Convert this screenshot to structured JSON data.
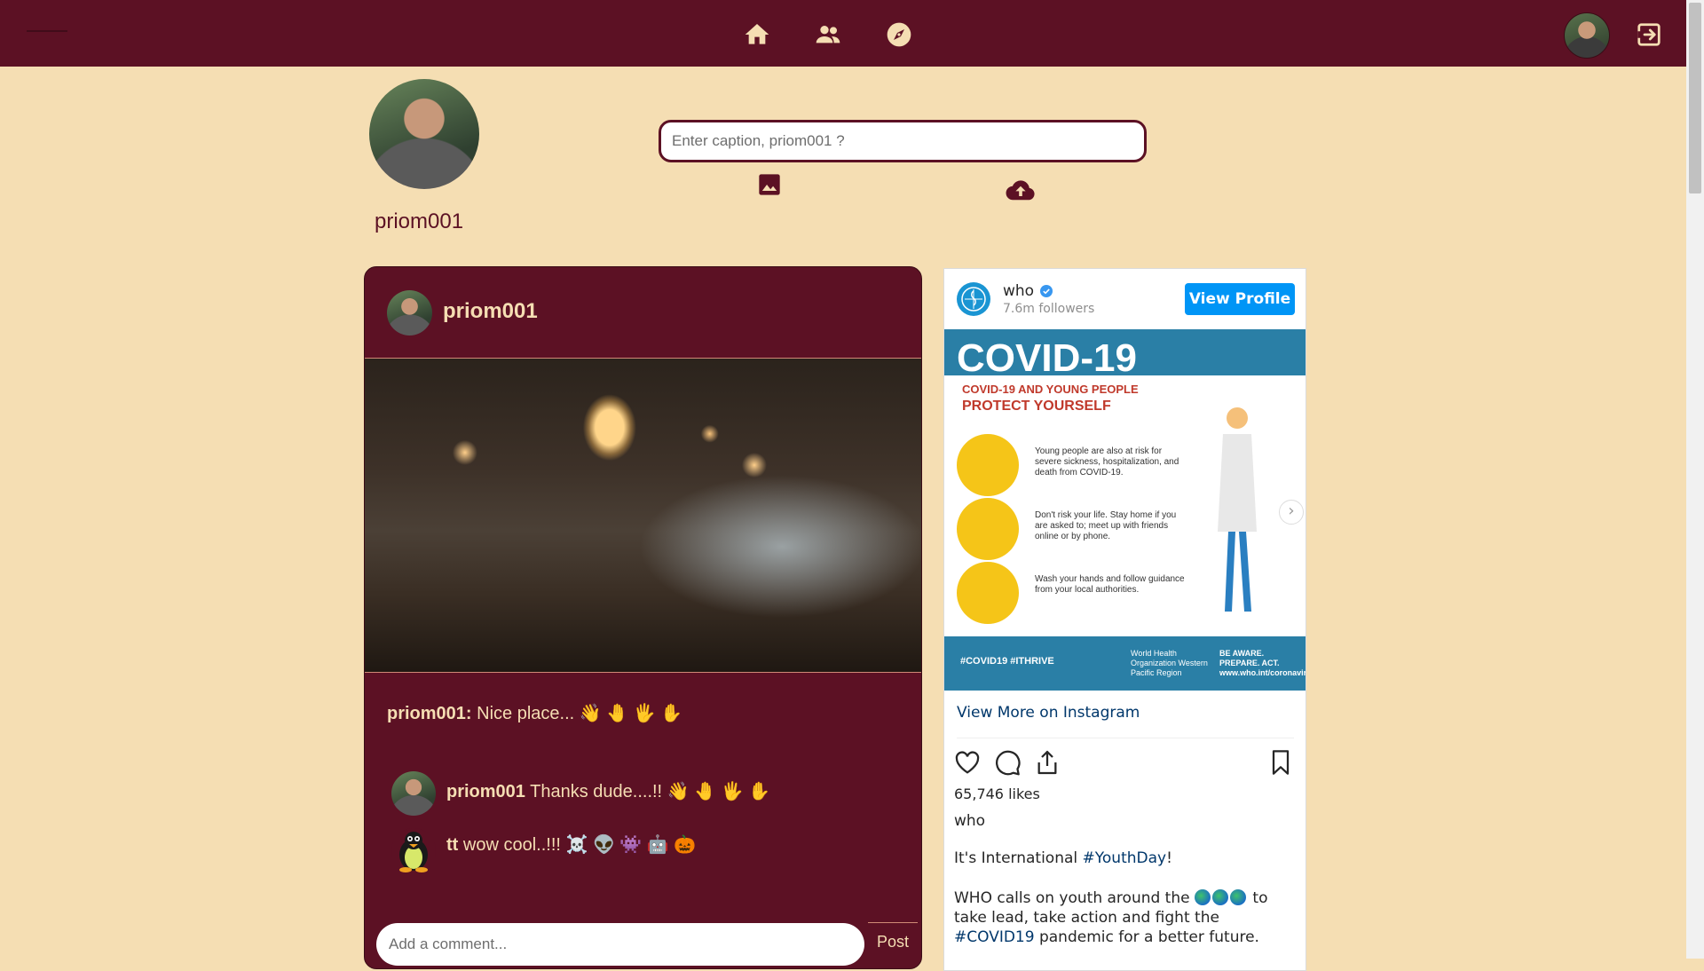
{
  "navbar": {
    "icons": [
      "home-icon",
      "friends-icon",
      "explore-icon",
      "logout-icon"
    ],
    "colors": {
      "bar": "#5c1124",
      "icon": "#f5deb3"
    }
  },
  "profile": {
    "username": "priom001"
  },
  "composer": {
    "placeholder": "Enter caption, priom001 ?"
  },
  "post": {
    "username": "priom001",
    "caption_user": "priom001:",
    "caption_text": "Nice place... 👋 🤚 🖐 ✋",
    "comments": [
      {
        "user": "priom001",
        "text": "Thanks dude....!! 👋 🤚 🖐 ✋"
      },
      {
        "user": "tt",
        "text": "wow cool..!!! ☠️ 👽 👾 🤖 🎃"
      }
    ],
    "comment_placeholder": "Add a comment...",
    "post_button": "Post"
  },
  "instagram_embed": {
    "account": "who",
    "followers": "7.6m followers",
    "view_profile": "View Profile",
    "graphic": {
      "title": "COVID-19",
      "subtitle_1": "COVID-19 AND YOUNG PEOPLE",
      "subtitle_2": "PROTECT YOURSELF",
      "item_1": "Young people are also at risk for severe sickness, hospitalization, and death from COVID-19.",
      "item_2": "Don't risk your life. Stay home if you are asked to; meet up with friends online or by phone.",
      "item_3": "Wash your hands and follow guidance from your local authorities.",
      "tags": "#COVID19   #ITHRIVE",
      "who_label": "World Health Organization Western Pacific Region",
      "aware": "BE AWARE. PREPARE. ACT. www.who.int/coronavirus"
    },
    "view_more": "View More on Instagram",
    "likes": "65,746 likes",
    "caption_user": "who",
    "caption_line1_pre": "It's International ",
    "caption_line1_tag": "#YouthDay",
    "caption_line1_post": "!",
    "caption_line2_pre": "WHO calls on youth around the ",
    "caption_line2_mid": " to take lead, take action and fight the ",
    "caption_line2_tag": "#COVID19",
    "caption_line2_post": " pandemic for a better future.",
    "action_icons": [
      "heart-icon",
      "comment-icon",
      "share-icon",
      "bookmark-icon"
    ]
  }
}
